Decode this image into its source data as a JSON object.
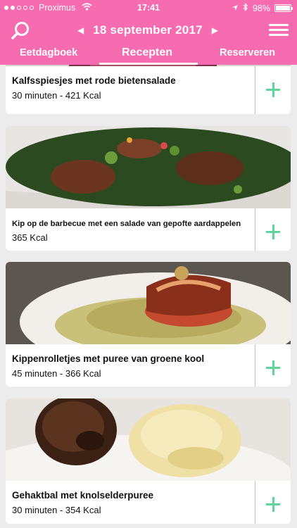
{
  "status": {
    "carrier": "Proximus",
    "time": "17:41",
    "battery": "98%",
    "battery_level": 0.98
  },
  "header": {
    "date": "18 september 2017",
    "tabs": [
      {
        "label": "Eetdagboek"
      },
      {
        "label": "Recepten",
        "active": true
      },
      {
        "label": "Reserveren"
      }
    ]
  },
  "recipes": [
    {
      "title": "Kalfsspiesjes met rode bietensalade",
      "subtitle": "30 minuten - 421 Kcal"
    },
    {
      "title": "Kip op de barbecue met een salade van gepofte aardappelen",
      "subtitle": "365 Kcal"
    },
    {
      "title": "Kippenrolletjes met puree van groene kool",
      "subtitle": "45 minuten - 366 Kcal"
    },
    {
      "title": "Gehaktbal met knolselderpuree",
      "subtitle": "30 minuten - 354 Kcal"
    }
  ],
  "colors": {
    "brand": "#f76bb1",
    "add": "#5fd49d"
  }
}
